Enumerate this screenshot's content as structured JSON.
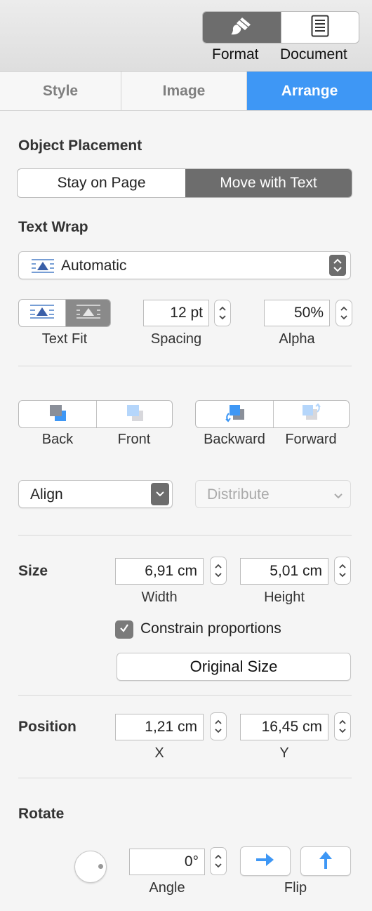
{
  "toolbar": {
    "format_label": "Format",
    "document_label": "Document"
  },
  "tabs": [
    {
      "label": "Style"
    },
    {
      "label": "Image"
    },
    {
      "label": "Arrange"
    }
  ],
  "object_placement": {
    "heading": "Object Placement",
    "options": [
      "Stay on Page",
      "Move with Text"
    ],
    "selected": "Move with Text"
  },
  "text_wrap": {
    "heading": "Text Wrap",
    "value": "Automatic",
    "text_fit_label": "Text Fit",
    "spacing_value": "12 pt",
    "spacing_label": "Spacing",
    "alpha_value": "50%",
    "alpha_label": "Alpha"
  },
  "layer": {
    "back": "Back",
    "front": "Front",
    "backward": "Backward",
    "forward": "Forward",
    "align": "Align",
    "distribute": "Distribute"
  },
  "size": {
    "heading": "Size",
    "width_value": "6,91 cm",
    "width_label": "Width",
    "height_value": "5,01 cm",
    "height_label": "Height",
    "constrain_label": "Constrain proportions",
    "constrain_checked": true,
    "original_size": "Original Size"
  },
  "position": {
    "heading": "Position",
    "x_value": "1,21 cm",
    "x_label": "X",
    "y_value": "16,45 cm",
    "y_label": "Y"
  },
  "rotate": {
    "heading": "Rotate",
    "angle_value": "0°",
    "angle_label": "Angle",
    "flip_label": "Flip"
  },
  "colors": {
    "accent": "#3e97f5",
    "selected_segment": "#6d6d6d"
  }
}
